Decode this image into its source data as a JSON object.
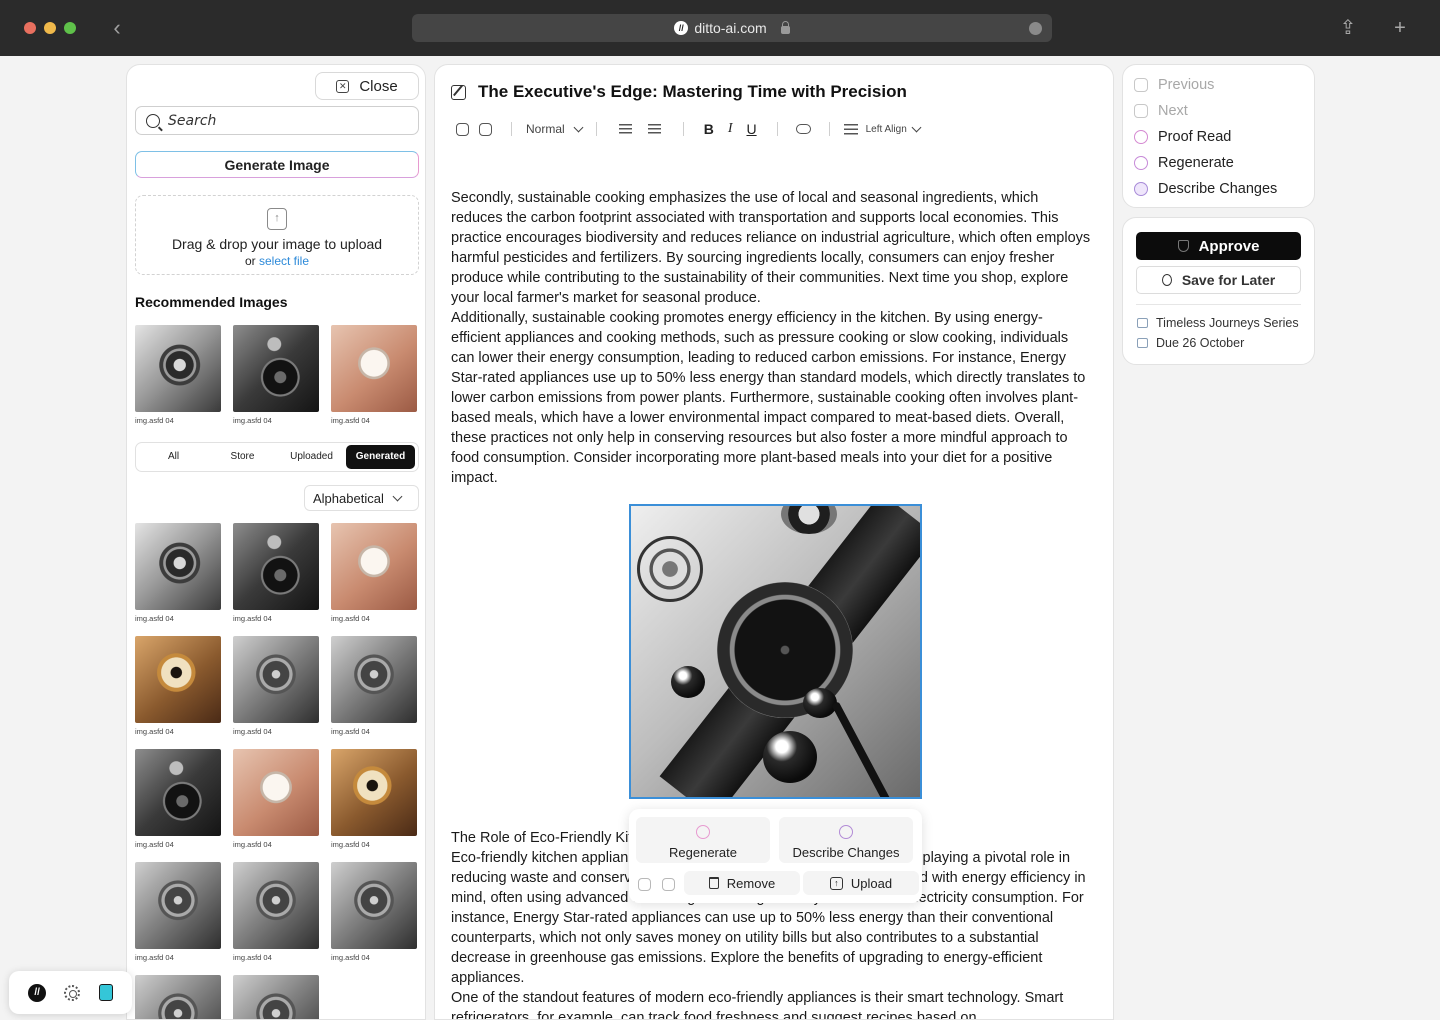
{
  "browser": {
    "url": "ditto-ai.com",
    "traffic_lights": [
      "#e8705f",
      "#f0b94b",
      "#5fc14a"
    ]
  },
  "left_panel": {
    "close_label": "Close",
    "search_placeholder": "Search",
    "generate_label": "Generate Image",
    "dropzone": {
      "text": "Drag & drop your image to upload",
      "or": "or",
      "link": "select file"
    },
    "recommended_title": "Recommended Images",
    "recommended": [
      {
        "caption": "img.asfd 04",
        "style": "w-dark"
      },
      {
        "caption": "img.asfd 04",
        "style": "w-black"
      },
      {
        "caption": "img.asfd 04",
        "style": "w-rose"
      }
    ],
    "tabs": [
      "All",
      "Store",
      "Uploaded",
      "Generated"
    ],
    "active_tab": "Generated",
    "sort_label": "Alphabetical",
    "gallery": [
      {
        "caption": "img.asfd 04",
        "style": "w-dark"
      },
      {
        "caption": "img.asfd 04",
        "style": "w-black"
      },
      {
        "caption": "img.asfd 04",
        "style": "w-rose"
      },
      {
        "caption": "img.asfd 04",
        "style": "w-gold"
      },
      {
        "caption": "img.asfd 04",
        "style": "w-chrono"
      },
      {
        "caption": "img.asfd 04",
        "style": "w-chrono"
      },
      {
        "caption": "img.asfd 04",
        "style": "w-black"
      },
      {
        "caption": "img.asfd 04",
        "style": "w-rose"
      },
      {
        "caption": "img.asfd 04",
        "style": "w-gold"
      },
      {
        "caption": "img.asfd 04",
        "style": "w-chrono"
      },
      {
        "caption": "img.asfd 04",
        "style": "w-chrono"
      },
      {
        "caption": "img.asfd 04",
        "style": "w-chrono"
      },
      {
        "caption": "",
        "style": "w-chrono"
      },
      {
        "caption": "",
        "style": "w-chrono"
      }
    ]
  },
  "editor": {
    "title": "The Executive's Edge: Mastering Time with Precision",
    "toolbar": {
      "style": "Normal",
      "bold": "B",
      "italic": "I",
      "underline": "U",
      "align": "Left Align"
    },
    "para1": "Secondly, sustainable cooking emphasizes the use of local and seasonal ingredients, which reduces the carbon footprint associated with transportation and supports local economies. This practice encourages biodiversity and reduces reliance on industrial agriculture, which often employs harmful pesticides and fertilizers. By sourcing ingredients locally, consumers can enjoy fresher produce while contributing to the sustainability of their communities. Next time you shop, explore your local farmer's market for seasonal produce.",
    "para2": "Additionally, sustainable cooking promotes energy efficiency in the kitchen. By using energy-efficient appliances and cooking methods, such as pressure cooking or slow cooking, individuals can lower their energy consumption, leading to reduced carbon emissions. For instance, Energy Star-rated appliances use up to 50% less energy than standard models, which directly translates to lower carbon emissions from power plants. Furthermore, sustainable cooking often involves plant-based meals, which have a lower environmental impact compared to meat-based diets. Overall, these practices not only help in conserving resources but also foster a more mindful approach to food consumption. Consider incorporating more plant-based meals into your diet for a positive impact.",
    "para3_heading": "The Role of Eco-Friendly Kitchen Appliances",
    "para3": "Eco-friendly kitchen appliances play a crucial role in sustainable cooking, playing a pivotal role in reducing waste and conserving resources. These appliances are designed with energy efficiency in mind, often using advanced technologies that significantly cut down on electricity consumption. For instance, Energy Star-rated appliances can use up to 50% less energy than their conventional counterparts, which not only saves money on utility bills but also contributes to a substantial decrease in greenhouse gas emissions. Explore the benefits of upgrading to energy-efficient appliances.",
    "para4": "One of the standout features of modern eco-friendly appliances is their smart technology. Smart refrigerators, for example, can track food freshness and suggest recipes based on",
    "image_popup": {
      "regenerate": "Regenerate",
      "describe": "Describe Changes",
      "remove": "Remove",
      "upload": "Upload"
    }
  },
  "right_panel": {
    "nav": [
      "Previous",
      "Next",
      "Proof Read",
      "Regenerate",
      "Describe Changes"
    ],
    "approve": "Approve",
    "save_later": "Save for Later",
    "series": "Timeless Journeys Series",
    "due": "Due 26 October"
  }
}
